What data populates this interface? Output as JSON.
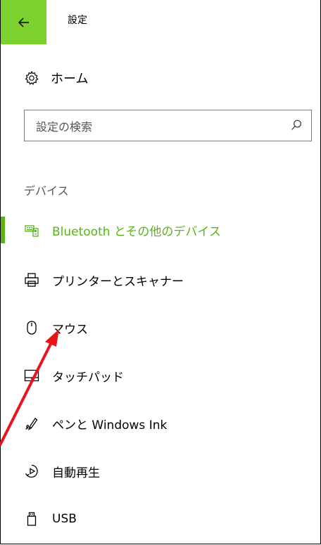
{
  "header": {
    "back_label": "←",
    "title": "設定"
  },
  "home": {
    "label": "ホーム"
  },
  "search": {
    "placeholder": "設定の検索"
  },
  "section": {
    "title": "デバイス"
  },
  "nav": {
    "items": [
      {
        "label": "Bluetooth とその他のデバイス",
        "icon": "keyboard-icon",
        "active": true
      },
      {
        "label": "プリンターとスキャナー",
        "icon": "printer-icon",
        "active": false
      },
      {
        "label": "マウス",
        "icon": "mouse-icon",
        "active": false
      },
      {
        "label": "タッチパッド",
        "icon": "touchpad-icon",
        "active": false
      },
      {
        "label": "ペンと Windows Ink",
        "icon": "pen-icon",
        "active": false
      },
      {
        "label": "自動再生",
        "icon": "autoplay-icon",
        "active": false
      },
      {
        "label": "USB",
        "icon": "usb-icon",
        "active": false
      }
    ]
  },
  "colors": {
    "accent": "#5ab31a",
    "back_button_bg": "#7dd12f",
    "annotation_arrow": "#e8141b"
  }
}
